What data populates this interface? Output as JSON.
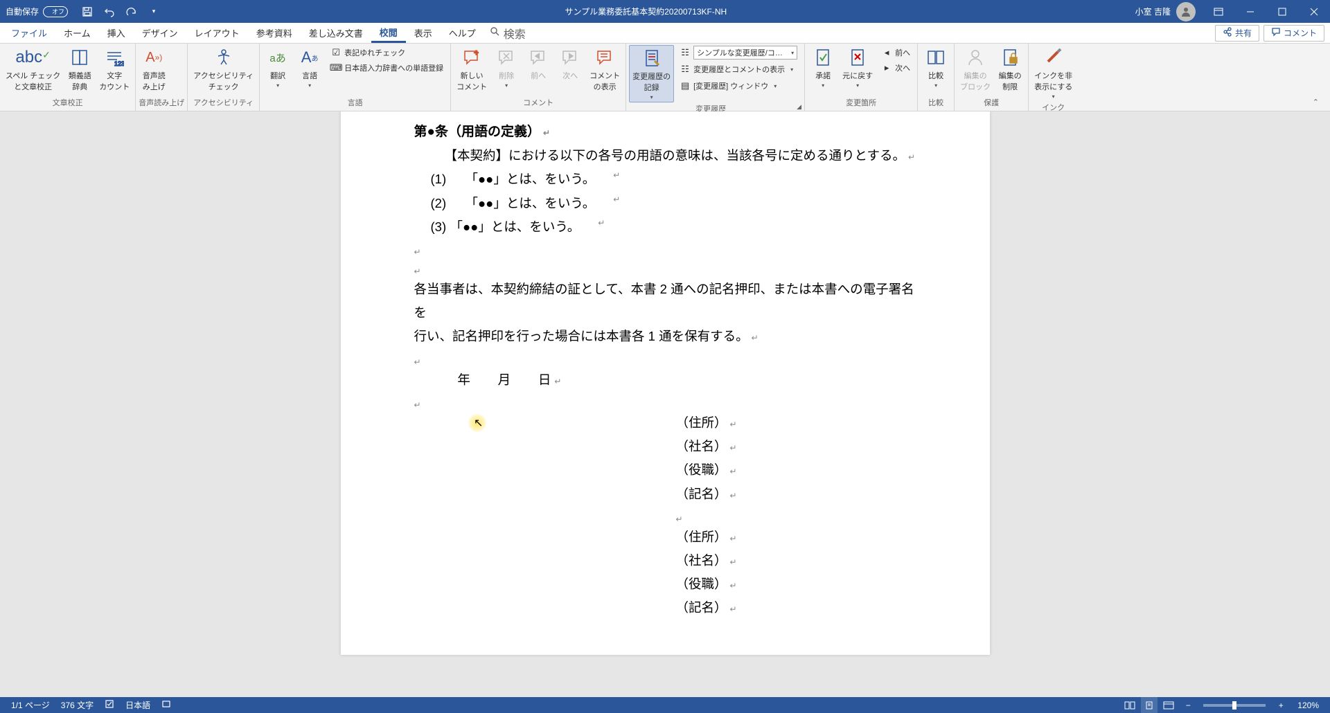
{
  "titlebar": {
    "autosave_label": "自動保存",
    "autosave_state": "オフ",
    "doc_title": "サンプル業務委託基本契約20200713KF-NH",
    "user_name": "小室 吉隆"
  },
  "tabs": {
    "file": "ファイル",
    "home": "ホーム",
    "insert": "挿入",
    "design": "デザイン",
    "layout": "レイアウト",
    "references": "参考資料",
    "mailings": "差し込み文書",
    "review": "校閲",
    "view": "表示",
    "help": "ヘルプ",
    "search": "検索",
    "share": "共有",
    "comments": "コメント"
  },
  "ribbon": {
    "proofing": {
      "spell": "スペル チェック\nと文章校正",
      "thesaurus": "類義語\n辞典",
      "wordcount": "文字\nカウント",
      "group": "文章校正"
    },
    "speech": {
      "readaloud": "音声読\nみ上げ",
      "group": "音声読み上げ"
    },
    "a11y": {
      "check": "アクセシビリティ\nチェック",
      "group": "アクセシビリティ"
    },
    "language": {
      "translate": "翻訳",
      "lang": "言語",
      "consistency": "表記ゆれチェック",
      "jpinput": "日本語入力辞書への単語登録",
      "group": "言語"
    },
    "comments": {
      "new": "新しい\nコメント",
      "delete": "削除",
      "prev": "前へ",
      "next": "次へ",
      "show": "コメント\nの表示",
      "group": "コメント"
    },
    "tracking": {
      "track": "変更履歴の\n記録",
      "display_combo": "シンプルな変更履歴/コ…",
      "show_markup": "変更履歴とコメントの表示",
      "pane": "[変更履歴] ウィンドウ",
      "group": "変更履歴"
    },
    "changes": {
      "accept": "承諾",
      "reject": "元に戻す",
      "prev": "前へ",
      "next": "次へ",
      "group": "変更箇所"
    },
    "compare": {
      "compare": "比較",
      "group": "比較"
    },
    "protect": {
      "block": "編集の\nブロック",
      "restrict": "編集の\n制限",
      "group": "保護"
    },
    "ink": {
      "hide": "インクを非\n表示にする",
      "group": "インク"
    }
  },
  "document": {
    "heading": "第●条（用語の定義）",
    "intro": "【本契約】における以下の各号の用語の意味は、当該各号に定める通りとする。",
    "items": [
      {
        "n": "(1)",
        "t": "「●●」とは、をいう。"
      },
      {
        "n": "(2)",
        "t": "「●●」とは、をいう。"
      },
      {
        "n": "(3)",
        "t": "「●●」とは、をいう。"
      }
    ],
    "closing1": "各当事者は、本契約締結の証として、本書 2 通への記名押印、または本書への電子署名を",
    "closing2": "行い、記名押印を行った場合には本書各 1 通を保有する。",
    "date_line": "　　年　　月　　日",
    "sig": [
      "（住所）",
      "（社名）",
      "（役職）",
      "（記名）"
    ]
  },
  "statusbar": {
    "page": "1/1 ページ",
    "words": "376 文字",
    "lang": "日本語",
    "zoom": "120%"
  }
}
